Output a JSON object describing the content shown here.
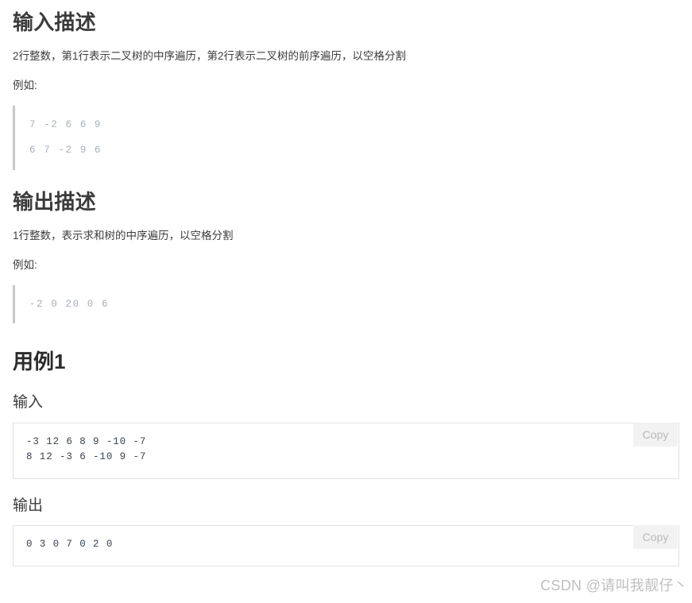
{
  "sections": {
    "input_desc": {
      "heading": "输入描述",
      "description": "2行整数，第1行表示二叉树的中序遍历，第2行表示二叉树的前序遍历，以空格分割",
      "example_label": "例如:",
      "sample_lines": [
        "7 -2 6 6 9",
        "6 7 -2 9 6"
      ]
    },
    "output_desc": {
      "heading": "输出描述",
      "description": "1行整数，表示求和树的中序遍历，以空格分割",
      "example_label": "例如:",
      "sample_lines": [
        "-2 0 20 0 6"
      ]
    },
    "example": {
      "heading": "用例1",
      "input": {
        "label": "输入",
        "code": "-3 12 6 8 9 -10 -7\n8 12 -3 6 -10 9 -7",
        "copy_label": "Copy"
      },
      "output": {
        "label": "输出",
        "code": "0 3 0 7 0 2 0",
        "copy_label": "Copy"
      }
    }
  },
  "watermark": "CSDN @请叫我靓仔丶",
  "colors": {
    "text": "#3c3c3c",
    "heading": "#3b3b3b",
    "code_text": "#39434f",
    "quote_text": "#a8b0b8",
    "quote_border": "#c8c8c8",
    "codebox_border": "#e2e2e2",
    "copy_bg": "#f2f2f2",
    "copy_text": "#b9b9b9",
    "watermark": "#bfbfbf"
  }
}
